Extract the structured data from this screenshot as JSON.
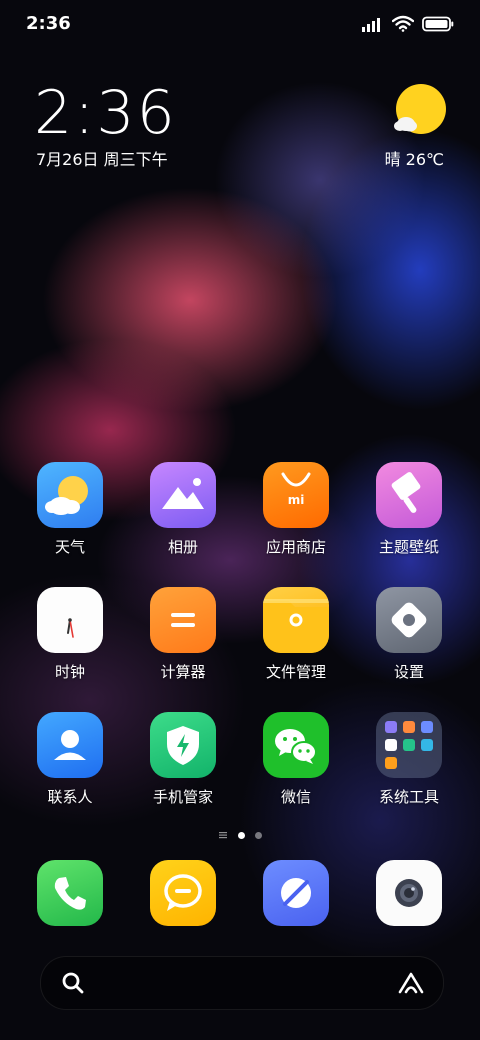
{
  "status_bar": {
    "time": "2:36"
  },
  "clock_widget": {
    "time": "2:36",
    "date": "7月26日 周三下午"
  },
  "weather_widget": {
    "condition": "晴",
    "temperature": "26℃",
    "icon": "sunny-icon"
  },
  "apps": [
    {
      "label": "天气",
      "icon": "weather-app-icon"
    },
    {
      "label": "相册",
      "icon": "gallery-icon"
    },
    {
      "label": "应用商店",
      "icon": "app-store-icon"
    },
    {
      "label": "主题壁纸",
      "icon": "themes-icon"
    },
    {
      "label": "时钟",
      "icon": "clock-icon"
    },
    {
      "label": "计算器",
      "icon": "calculator-icon"
    },
    {
      "label": "文件管理",
      "icon": "file-manager-icon"
    },
    {
      "label": "设置",
      "icon": "settings-icon"
    },
    {
      "label": "联系人",
      "icon": "contacts-icon"
    },
    {
      "label": "手机管家",
      "icon": "security-icon"
    },
    {
      "label": "微信",
      "icon": "wechat-icon"
    },
    {
      "label": "系统工具",
      "icon": "system-tools-folder-icon"
    }
  ],
  "dock": [
    {
      "icon": "phone-icon"
    },
    {
      "icon": "messages-icon"
    },
    {
      "icon": "browser-icon"
    },
    {
      "icon": "camera-icon"
    }
  ],
  "page_indicator": {
    "pages": 2,
    "current": 1
  },
  "search_bar": {
    "left_icon": "search-icon",
    "right_icon": "assistant-icon"
  },
  "colors": {
    "weather_sun": "#ffd21f",
    "wechat_green": "#1fc02b",
    "store_orange": "#ff7a00"
  }
}
